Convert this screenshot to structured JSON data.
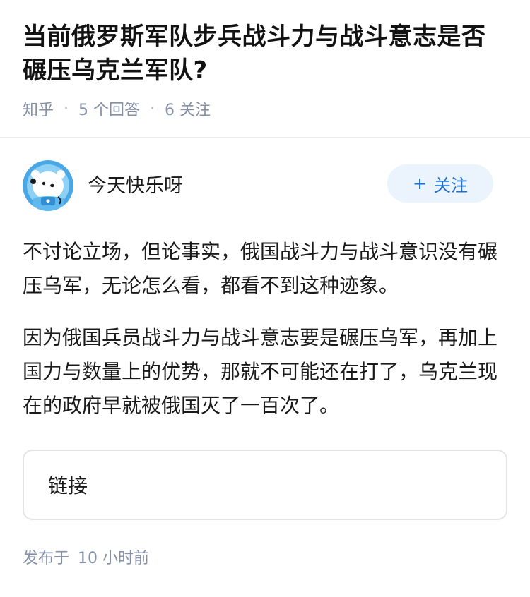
{
  "question": {
    "title": "当前俄罗斯军队步兵战斗力与战斗意志是否碾压乌克兰军队?",
    "source": "知乎",
    "separator": "·",
    "answers": "5 个回答",
    "followers": "6 关注"
  },
  "answer": {
    "author_name": "今天快乐呀",
    "follow_button": {
      "icon": "plus-icon",
      "icon_glyph": "+",
      "label": "关注"
    },
    "paragraphs": [
      "不讨论立场，但论事实，俄国战斗力与战斗意识没有碾压乌军，无论怎么看，都看不到这种迹象。",
      "因为俄国兵员战斗力与战斗意志要是碾压乌军，再加上国力与数量上的优势，那就不可能还在打了，乌克兰现在的政府早就被俄国灭了一百次了。"
    ],
    "link_card_label": "链接",
    "published_prefix": "发布于",
    "published_time": "10 小时前"
  },
  "colors": {
    "accent": "#1a6fd1",
    "follow_bg": "#ebf3fd",
    "meta_text": "#8590a6",
    "avatar_bg": "#4aa7e6"
  }
}
